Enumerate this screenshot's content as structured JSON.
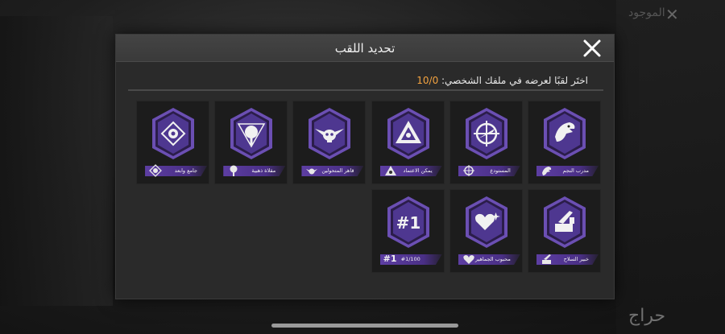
{
  "background": {
    "top_right_text": "الموجود",
    "left_items": [
      "",
      "",
      ""
    ],
    "watermark": "حراج"
  },
  "dialog": {
    "title": "تحديد اللقب",
    "close_icon": "close-icon",
    "instruction_prefix": "اختَر لقبًا لعرضه في ملفك الشخصي: ",
    "instruction_count": "10/0"
  },
  "titles": [
    {
      "label": "مدرب النجم",
      "icon": "eagle-icon",
      "mini": "eagle-mini-icon"
    },
    {
      "label": "المستودع",
      "icon": "crosshair-icon",
      "mini": "crosshair-mini-icon"
    },
    {
      "label": "يمكن الاعتماد",
      "icon": "triangle-eye-icon",
      "mini": "triangle-mini-icon"
    },
    {
      "label": "قاهر المتحولين",
      "icon": "winged-skull-icon",
      "mini": "winged-mini-icon"
    },
    {
      "label": "مقلاة ذهبية",
      "icon": "pan-icon",
      "mini": "pan-mini-icon"
    },
    {
      "label": "جامع وابعد",
      "icon": "target-diamond-icon",
      "mini": "target-mini-icon"
    },
    {
      "label": "خبير السلاح",
      "icon": "crate-gun-icon",
      "mini": "crate-mini-icon"
    },
    {
      "label": "محبوب الجماهير",
      "icon": "hearts-icon",
      "mini": "hearts-mini-icon"
    },
    {
      "label": "#1/100",
      "icon": "rank-one-icon",
      "mini_text": "#1",
      "badge_text": "#1"
    }
  ],
  "colors": {
    "accent_purple": "#5d3ea3",
    "count_orange": "#f4a340"
  }
}
